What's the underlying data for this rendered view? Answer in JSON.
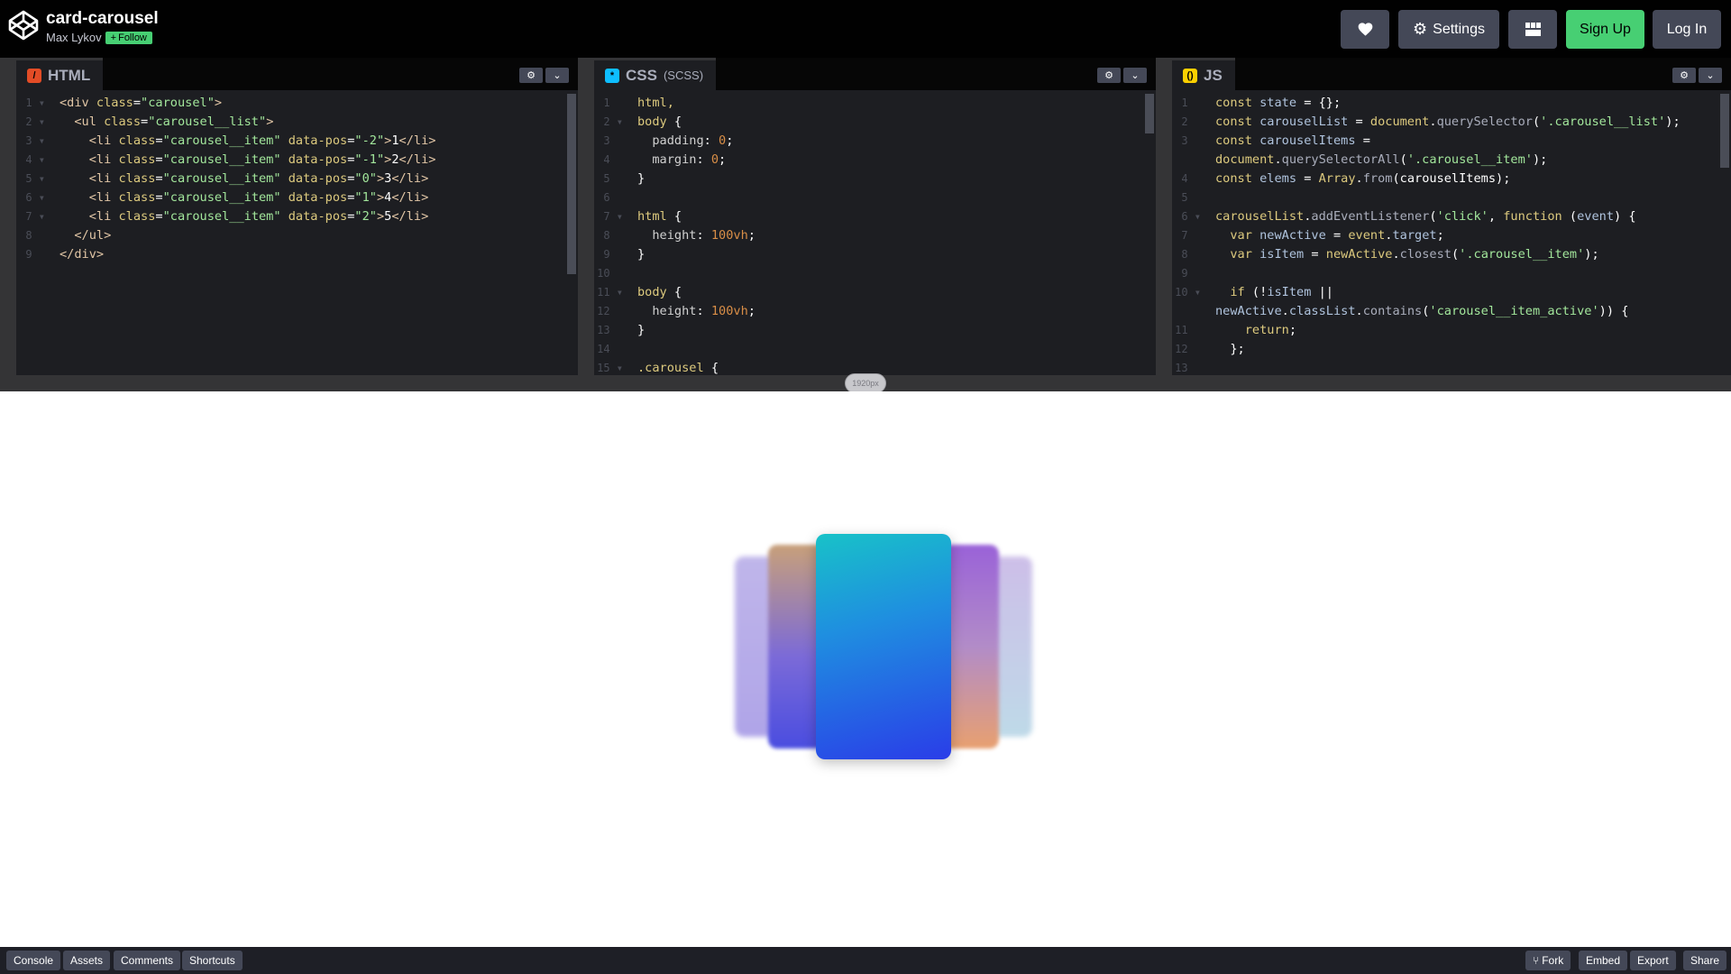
{
  "header": {
    "title": "card-carousel",
    "author": "Max Lykov",
    "follow_label": "Follow",
    "settings_label": "Settings",
    "signup_label": "Sign Up",
    "login_label": "Log In"
  },
  "editors": {
    "html": {
      "name": "HTML",
      "lines": [
        {
          "n": "1",
          "fold": true,
          "code": [
            [
              "t-tag",
              "<div "
            ],
            [
              "t-attr",
              "class"
            ],
            [
              "t-pl",
              "="
            ],
            [
              "t-str",
              "\"carousel\""
            ],
            [
              "t-tag",
              ">"
            ]
          ]
        },
        {
          "n": "2",
          "fold": true,
          "code": [
            [
              "t-pl",
              "  "
            ],
            [
              "t-tag",
              "<ul "
            ],
            [
              "t-attr",
              "class"
            ],
            [
              "t-pl",
              "="
            ],
            [
              "t-str",
              "\"carousel__list\""
            ],
            [
              "t-tag",
              ">"
            ]
          ]
        },
        {
          "n": "3",
          "fold": true,
          "code": [
            [
              "t-pl",
              "    "
            ],
            [
              "t-tag",
              "<li "
            ],
            [
              "t-attr",
              "class"
            ],
            [
              "t-pl",
              "="
            ],
            [
              "t-str",
              "\"carousel__item\""
            ],
            [
              "t-pl",
              " "
            ],
            [
              "t-attr",
              "data-pos"
            ],
            [
              "t-pl",
              "="
            ],
            [
              "t-str",
              "\"-2\""
            ],
            [
              "t-tag",
              ">"
            ],
            [
              "t-pl",
              "1"
            ],
            [
              "t-tag",
              "</li>"
            ]
          ]
        },
        {
          "n": "4",
          "fold": true,
          "code": [
            [
              "t-pl",
              "    "
            ],
            [
              "t-tag",
              "<li "
            ],
            [
              "t-attr",
              "class"
            ],
            [
              "t-pl",
              "="
            ],
            [
              "t-str",
              "\"carousel__item\""
            ],
            [
              "t-pl",
              " "
            ],
            [
              "t-attr",
              "data-pos"
            ],
            [
              "t-pl",
              "="
            ],
            [
              "t-str",
              "\"-1\""
            ],
            [
              "t-tag",
              ">"
            ],
            [
              "t-pl",
              "2"
            ],
            [
              "t-tag",
              "</li>"
            ]
          ]
        },
        {
          "n": "5",
          "fold": true,
          "code": [
            [
              "t-pl",
              "    "
            ],
            [
              "t-tag",
              "<li "
            ],
            [
              "t-attr",
              "class"
            ],
            [
              "t-pl",
              "="
            ],
            [
              "t-str",
              "\"carousel__item\""
            ],
            [
              "t-pl",
              " "
            ],
            [
              "t-attr",
              "data-pos"
            ],
            [
              "t-pl",
              "="
            ],
            [
              "t-str",
              "\"0\""
            ],
            [
              "t-tag",
              ">"
            ],
            [
              "t-pl",
              "3"
            ],
            [
              "t-tag",
              "</li>"
            ]
          ]
        },
        {
          "n": "6",
          "fold": true,
          "code": [
            [
              "t-pl",
              "    "
            ],
            [
              "t-tag",
              "<li "
            ],
            [
              "t-attr",
              "class"
            ],
            [
              "t-pl",
              "="
            ],
            [
              "t-str",
              "\"carousel__item\""
            ],
            [
              "t-pl",
              " "
            ],
            [
              "t-attr",
              "data-pos"
            ],
            [
              "t-pl",
              "="
            ],
            [
              "t-str",
              "\"1\""
            ],
            [
              "t-tag",
              ">"
            ],
            [
              "t-pl",
              "4"
            ],
            [
              "t-tag",
              "</li>"
            ]
          ]
        },
        {
          "n": "7",
          "fold": true,
          "code": [
            [
              "t-pl",
              "    "
            ],
            [
              "t-tag",
              "<li "
            ],
            [
              "t-attr",
              "class"
            ],
            [
              "t-pl",
              "="
            ],
            [
              "t-str",
              "\"carousel__item\""
            ],
            [
              "t-pl",
              " "
            ],
            [
              "t-attr",
              "data-pos"
            ],
            [
              "t-pl",
              "="
            ],
            [
              "t-str",
              "\"2\""
            ],
            [
              "t-tag",
              ">"
            ],
            [
              "t-pl",
              "5"
            ],
            [
              "t-tag",
              "</li>"
            ]
          ]
        },
        {
          "n": "8",
          "fold": false,
          "code": [
            [
              "t-pl",
              "  "
            ],
            [
              "t-tag",
              "</ul>"
            ]
          ]
        },
        {
          "n": "9",
          "fold": false,
          "code": [
            [
              "t-tag",
              "</div>"
            ]
          ]
        }
      ]
    },
    "css": {
      "name": "CSS",
      "sub": "(SCSS)",
      "lines": [
        {
          "n": "1",
          "fold": false,
          "code": [
            [
              "t-sel",
              "html,"
            ]
          ]
        },
        {
          "n": "2",
          "fold": true,
          "code": [
            [
              "t-sel",
              "body "
            ],
            [
              "t-pl",
              "{"
            ]
          ]
        },
        {
          "n": "3",
          "fold": false,
          "code": [
            [
              "t-pl",
              "  "
            ],
            [
              "t-prop",
              "padding"
            ],
            [
              "t-pl",
              ": "
            ],
            [
              "t-num",
              "0"
            ],
            [
              "t-pl",
              ";"
            ]
          ]
        },
        {
          "n": "4",
          "fold": false,
          "code": [
            [
              "t-pl",
              "  "
            ],
            [
              "t-prop",
              "margin"
            ],
            [
              "t-pl",
              ": "
            ],
            [
              "t-num",
              "0"
            ],
            [
              "t-pl",
              ";"
            ]
          ]
        },
        {
          "n": "5",
          "fold": false,
          "code": [
            [
              "t-pl",
              "}"
            ]
          ]
        },
        {
          "n": "6",
          "fold": false,
          "code": []
        },
        {
          "n": "7",
          "fold": true,
          "code": [
            [
              "t-sel",
              "html "
            ],
            [
              "t-pl",
              "{"
            ]
          ]
        },
        {
          "n": "8",
          "fold": false,
          "code": [
            [
              "t-pl",
              "  "
            ],
            [
              "t-prop",
              "height"
            ],
            [
              "t-pl",
              ": "
            ],
            [
              "t-num",
              "100vh"
            ],
            [
              "t-pl",
              ";"
            ]
          ]
        },
        {
          "n": "9",
          "fold": false,
          "code": [
            [
              "t-pl",
              "}"
            ]
          ]
        },
        {
          "n": "10",
          "fold": false,
          "code": []
        },
        {
          "n": "11",
          "fold": true,
          "code": [
            [
              "t-sel",
              "body "
            ],
            [
              "t-pl",
              "{"
            ]
          ]
        },
        {
          "n": "12",
          "fold": false,
          "code": [
            [
              "t-pl",
              "  "
            ],
            [
              "t-prop",
              "height"
            ],
            [
              "t-pl",
              ": "
            ],
            [
              "t-num",
              "100vh"
            ],
            [
              "t-pl",
              ";"
            ]
          ]
        },
        {
          "n": "13",
          "fold": false,
          "code": [
            [
              "t-pl",
              "}"
            ]
          ]
        },
        {
          "n": "14",
          "fold": false,
          "code": []
        },
        {
          "n": "15",
          "fold": true,
          "code": [
            [
              "t-sel",
              ".carousel "
            ],
            [
              "t-pl",
              "{"
            ]
          ]
        }
      ]
    },
    "js": {
      "name": "JS",
      "lines": [
        {
          "n": "1",
          "fold": false,
          "code": [
            [
              "t-kw",
              "const "
            ],
            [
              "t-var",
              "state"
            ],
            [
              "t-pl",
              " = {};"
            ]
          ]
        },
        {
          "n": "2",
          "fold": false,
          "code": [
            [
              "t-kw",
              "const "
            ],
            [
              "t-var",
              "carouselList"
            ],
            [
              "t-pl",
              " = "
            ],
            [
              "t-kw",
              "document"
            ],
            [
              "t-pl",
              "."
            ],
            [
              "t-fn",
              "querySelector"
            ],
            [
              "t-pl",
              "("
            ],
            [
              "t-str",
              "'.carousel__list'"
            ],
            [
              "t-pl",
              ");"
            ]
          ]
        },
        {
          "n": "3",
          "fold": false,
          "code": [
            [
              "t-kw",
              "const "
            ],
            [
              "t-var",
              "carouselItems"
            ],
            [
              "t-pl",
              " ="
            ]
          ]
        },
        {
          "n": "",
          "fold": false,
          "code": [
            [
              "t-kw",
              "document"
            ],
            [
              "t-pl",
              "."
            ],
            [
              "t-fn",
              "querySelectorAll"
            ],
            [
              "t-pl",
              "("
            ],
            [
              "t-str",
              "'.carousel__item'"
            ],
            [
              "t-pl",
              ");"
            ]
          ]
        },
        {
          "n": "4",
          "fold": false,
          "code": [
            [
              "t-kw",
              "const "
            ],
            [
              "t-var",
              "elems"
            ],
            [
              "t-pl",
              " = "
            ],
            [
              "t-kw",
              "Array"
            ],
            [
              "t-pl",
              "."
            ],
            [
              "t-fn",
              "from"
            ],
            [
              "t-pl",
              "(carouselItems);"
            ]
          ]
        },
        {
          "n": "5",
          "fold": false,
          "code": []
        },
        {
          "n": "6",
          "fold": true,
          "code": [
            [
              "t-kw",
              "carouselList"
            ],
            [
              "t-pl",
              "."
            ],
            [
              "t-fn",
              "addEventListener"
            ],
            [
              "t-pl",
              "("
            ],
            [
              "t-str",
              "'click'"
            ],
            [
              "t-pl",
              ", "
            ],
            [
              "t-kw",
              "function"
            ],
            [
              "t-pl",
              " ("
            ],
            [
              "t-var",
              "event"
            ],
            [
              "t-pl",
              ") {"
            ]
          ]
        },
        {
          "n": "7",
          "fold": false,
          "code": [
            [
              "t-pl",
              "  "
            ],
            [
              "t-kw",
              "var "
            ],
            [
              "t-var",
              "newActive"
            ],
            [
              "t-pl",
              " = "
            ],
            [
              "t-kw",
              "event"
            ],
            [
              "t-pl",
              "."
            ],
            [
              "t-var",
              "target"
            ],
            [
              "t-pl",
              ";"
            ]
          ]
        },
        {
          "n": "8",
          "fold": false,
          "code": [
            [
              "t-pl",
              "  "
            ],
            [
              "t-kw",
              "var "
            ],
            [
              "t-var",
              "isItem"
            ],
            [
              "t-pl",
              " = "
            ],
            [
              "t-kw",
              "newActive"
            ],
            [
              "t-pl",
              "."
            ],
            [
              "t-fn",
              "closest"
            ],
            [
              "t-pl",
              "("
            ],
            [
              "t-str",
              "'.carousel__item'"
            ],
            [
              "t-pl",
              ");"
            ]
          ]
        },
        {
          "n": "9",
          "fold": false,
          "code": []
        },
        {
          "n": "10",
          "fold": true,
          "code": [
            [
              "t-pl",
              "  "
            ],
            [
              "t-kw",
              "if"
            ],
            [
              "t-pl",
              " (!"
            ],
            [
              "t-var",
              "isItem"
            ],
            [
              "t-pl",
              " ||"
            ]
          ]
        },
        {
          "n": "",
          "fold": false,
          "code": [
            [
              "t-var",
              "newActive"
            ],
            [
              "t-pl",
              "."
            ],
            [
              "t-var",
              "classList"
            ],
            [
              "t-pl",
              "."
            ],
            [
              "t-fn",
              "contains"
            ],
            [
              "t-pl",
              "("
            ],
            [
              "t-str",
              "'carousel__item_active'"
            ],
            [
              "t-pl",
              ")) {"
            ]
          ]
        },
        {
          "n": "11",
          "fold": false,
          "code": [
            [
              "t-pl",
              "    "
            ],
            [
              "t-kw",
              "return"
            ],
            [
              "t-pl",
              ";"
            ]
          ]
        },
        {
          "n": "12",
          "fold": false,
          "code": [
            [
              "t-pl",
              "  };"
            ]
          ]
        },
        {
          "n": "13",
          "fold": false,
          "code": []
        }
      ]
    }
  },
  "size_indicator": "1920px",
  "footer": {
    "console": "Console",
    "assets": "Assets",
    "comments": "Comments",
    "shortcuts": "Shortcuts",
    "fork": "Fork",
    "embed": "Embed",
    "export": "Export",
    "share": "Share"
  },
  "colors": {
    "follow_green": "#47cf73",
    "html_icon": "#e34c26",
    "css_icon": "#0ebeff",
    "js_icon": "#fcd000"
  }
}
